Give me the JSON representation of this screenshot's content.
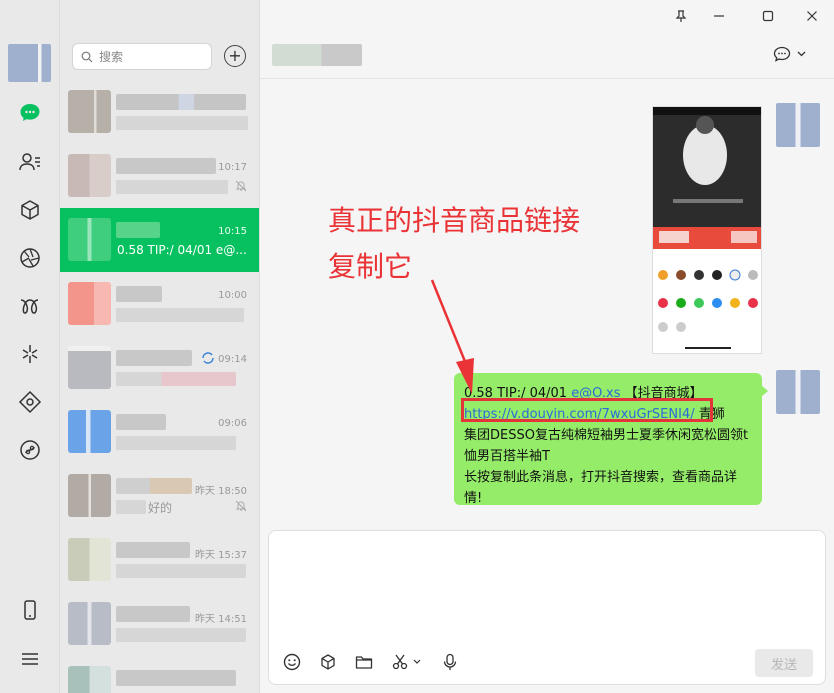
{
  "window": {
    "pin_glyph": "⚲",
    "minimize_glyph": "—",
    "maximize_glyph": "☐",
    "close_glyph": "✕"
  },
  "search": {
    "placeholder": "搜索"
  },
  "add_glyph": "+",
  "chats": [
    {
      "time": "",
      "preview": ""
    },
    {
      "time": "10:17",
      "preview": ""
    },
    {
      "time": "10:15",
      "preview": "0.58 TIP:/ 04/01 e@..."
    },
    {
      "time": "10:00",
      "preview": ""
    },
    {
      "time": "09:14",
      "preview": ""
    },
    {
      "time": "09:06",
      "preview": ""
    },
    {
      "time": "昨天 18:50",
      "preview": "好的"
    },
    {
      "time": "昨天 15:37",
      "preview": ""
    },
    {
      "time": "昨天 14:51",
      "preview": ""
    }
  ],
  "message": {
    "line1_prefix": "0.58 TIP:/ 04/01 ",
    "line1_mention": "e@O.xs",
    "line1_suffix": " 【抖音商城】",
    "link": "https://v.douyin.com/7wxuGrSENI4/",
    "link_suffix": " 青狮",
    "rest": "集团DESSO复古纯棉短袖男士夏季休闲宽松圆领t恤男百搭半袖T",
    "line_last": "长按复制此条消息，打开抖音搜索，查看商品详情!"
  },
  "annotation": {
    "line1": "真正的抖音商品链接",
    "line2": "复制它"
  },
  "input": {
    "send_label": "发送"
  },
  "colors": {
    "accent": "#07c160",
    "bubble": "#95ec69",
    "annotation": "#ea3336",
    "link": "#2b6bd8"
  }
}
